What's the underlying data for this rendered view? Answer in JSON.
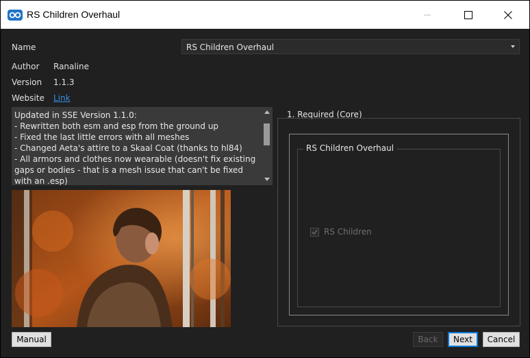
{
  "window": {
    "title": "RS Children Overhaul"
  },
  "info": {
    "name_label": "Name",
    "name_value": "RS Children Overhaul",
    "author_label": "Author",
    "author_value": "Ranaline",
    "version_label": "Version",
    "version_value": "1.1.3",
    "website_label": "Website",
    "website_link": "Link"
  },
  "description": "Updated in SSE Version 1.1.0:\n- Rewritten both esm and esp from the ground up\n- Fixed the last little errors with all meshes\n- Changed Aeta's attire to a Skaal Coat (thanks to hl84)\n- All armors and clothes now wearable (doesn't fix existing gaps or bodies - that is a mesh issue that can't be fixed with an .esp)",
  "step": {
    "title": "1. Required (Core)",
    "group_title": "RS Children Overhaul",
    "option_label": "RS Children",
    "option_checked": true
  },
  "buttons": {
    "manual": "Manual",
    "back": "Back",
    "next": "Next",
    "cancel": "Cancel"
  },
  "colors": {
    "background": "#202020",
    "link": "#3a8ee6",
    "focus": "#0078d7"
  }
}
